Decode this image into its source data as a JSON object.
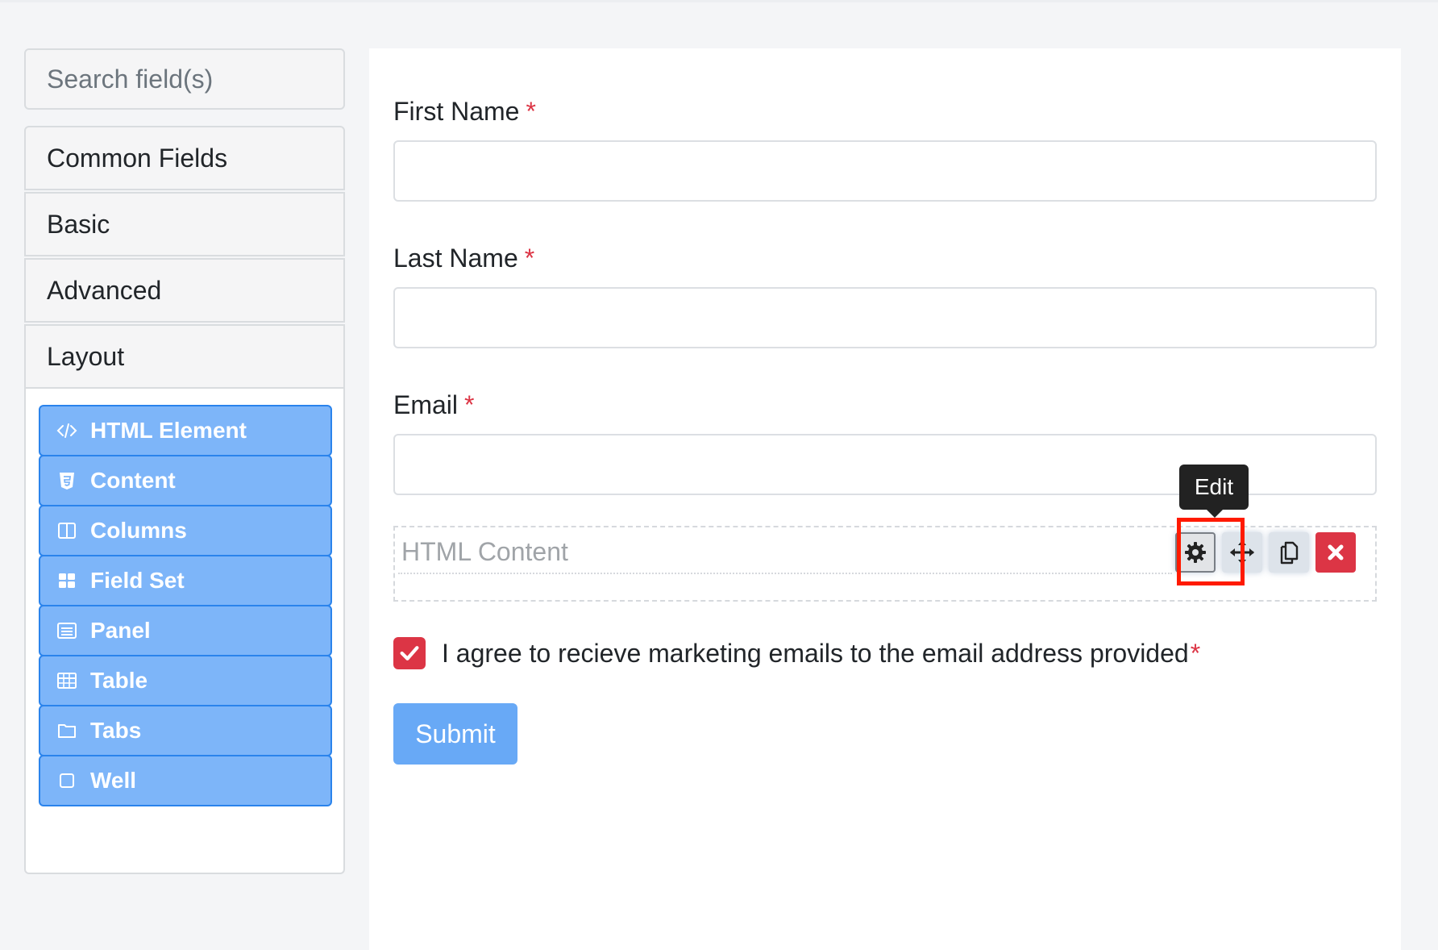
{
  "sidebar": {
    "search_placeholder": "Search field(s)",
    "groups": [
      {
        "label": "Common Fields"
      },
      {
        "label": "Basic"
      },
      {
        "label": "Advanced"
      },
      {
        "label": "Layout"
      }
    ],
    "layout_components": [
      {
        "label": "HTML Element",
        "icon": "code-icon"
      },
      {
        "label": "Content",
        "icon": "html5-icon"
      },
      {
        "label": "Columns",
        "icon": "columns-icon"
      },
      {
        "label": "Field Set",
        "icon": "th-large-icon"
      },
      {
        "label": "Panel",
        "icon": "list-alt-icon"
      },
      {
        "label": "Table",
        "icon": "table-icon"
      },
      {
        "label": "Tabs",
        "icon": "folder-icon"
      },
      {
        "label": "Well",
        "icon": "square-icon"
      }
    ]
  },
  "form": {
    "first_name_label": "First Name",
    "last_name_label": "Last Name",
    "email_label": "Email",
    "required_marker": "*",
    "html_content_placeholder": "HTML Content",
    "tooltip": "Edit",
    "agree_label": "I agree to recieve marketing emails to the email address provided",
    "agree_checked": true,
    "submit_label": "Submit"
  },
  "colors": {
    "component_button_bg": "#7db5f9",
    "component_button_border": "#2a83ec",
    "required": "#dc3545",
    "highlight": "#ff1a00",
    "submit_bg": "#68a9f6"
  }
}
